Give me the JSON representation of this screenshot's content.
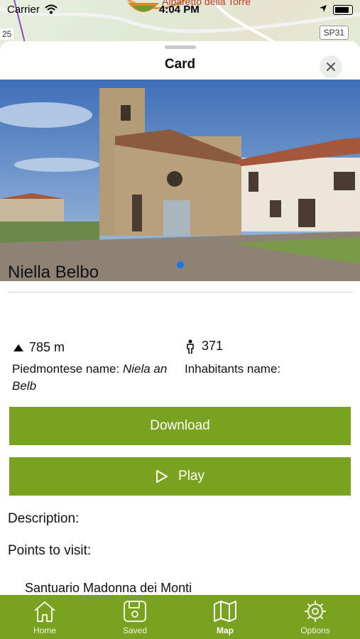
{
  "status_bar": {
    "carrier": "Carrier",
    "time": "4:04 PM"
  },
  "map": {
    "town_label": "Albaretto della Torre",
    "road_sign": "SP31",
    "road_number": "25"
  },
  "sheet": {
    "title": "Card",
    "close_label": "×"
  },
  "place": {
    "name": "Niella Belbo",
    "altitude": "785 m",
    "population": "371",
    "piedmontese_label": "Piedmontese name:",
    "piedmontese_value": "Niela an Belb",
    "inhabitants_label": "Inhabitants name:"
  },
  "buttons": {
    "download": "Download",
    "play": "Play"
  },
  "sections": {
    "description": "Description:",
    "points": "Points to visit:"
  },
  "points_to_visit": [
    "Santuario Madonna dei Monti"
  ],
  "gallery": {
    "page_count": 1,
    "current_page": 1
  },
  "tabs": [
    {
      "label": "Home",
      "icon": "home-icon"
    },
    {
      "label": "Saved",
      "icon": "saved-icon"
    },
    {
      "label": "Map",
      "icon": "map-icon",
      "active": true
    },
    {
      "label": "Options",
      "icon": "options-icon"
    }
  ],
  "colors": {
    "accent": "#7aa221",
    "page_dot": "#1e73e8"
  }
}
